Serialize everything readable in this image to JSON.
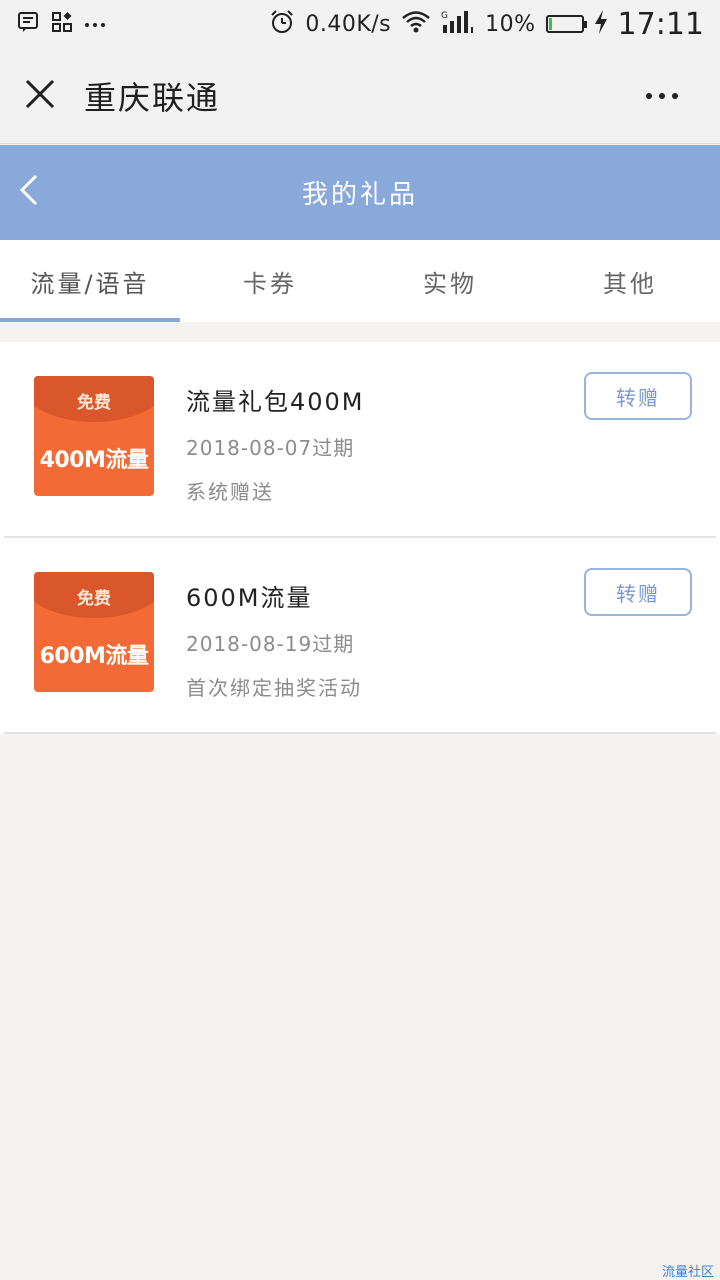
{
  "status_bar": {
    "net_speed": "0.40K/s",
    "battery_percent": "10%",
    "battery_level": 0.1,
    "time": "17:11",
    "icons": [
      "message-icon",
      "app-grid-icon",
      "more-notifications-icon",
      "alarm-icon",
      "wifi-icon",
      "signal-icon",
      "charging-icon"
    ]
  },
  "titlebar": {
    "title": "重庆联通"
  },
  "page": {
    "title": "我的礼品"
  },
  "tabs": [
    {
      "label": "流量/语音",
      "active": true
    },
    {
      "label": "卡券",
      "active": false
    },
    {
      "label": "实物",
      "active": false
    },
    {
      "label": "其他",
      "active": false
    }
  ],
  "gifts": [
    {
      "badge_free": "免费",
      "badge_amount": "400M流量",
      "title": "流量礼包400M",
      "expiry": "2018-08-07过期",
      "source": "系统赠送",
      "button": "转赠"
    },
    {
      "badge_free": "免费",
      "badge_amount": "600M流量",
      "title": "600M流量",
      "expiry": "2018-08-19过期",
      "source": "首次绑定抽奖活动",
      "button": "转赠"
    }
  ],
  "watermark": "流量社区",
  "colors": {
    "header": "#89a9db",
    "badge": "#f26a36",
    "badge_top": "#d9572b",
    "button_border": "#9ab3de",
    "battery": "#3cc34a"
  }
}
